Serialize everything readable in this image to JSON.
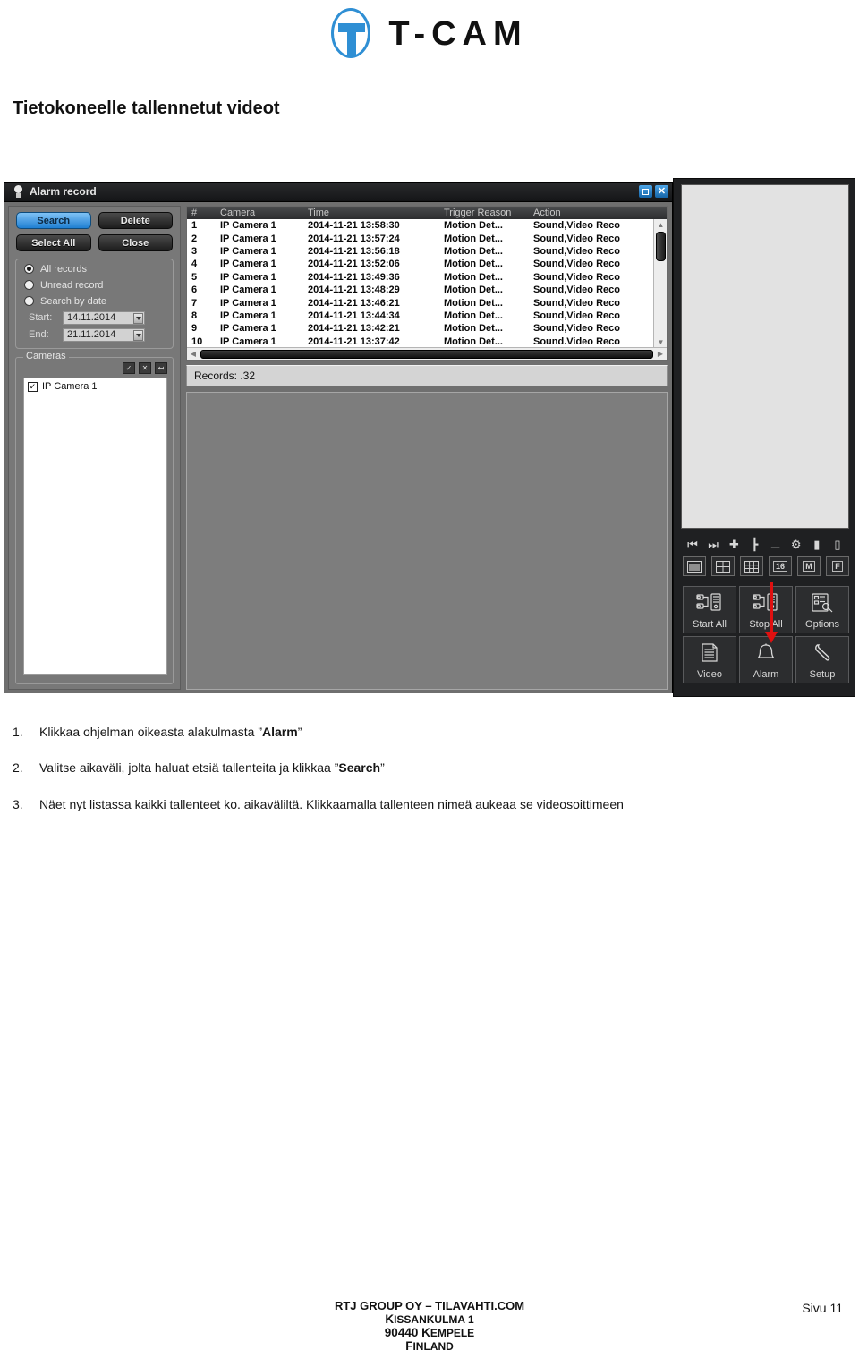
{
  "logo": {
    "mark": "t-cam-logo",
    "text": "T-CAM"
  },
  "page_title": "Tietokoneelle tallennetut videot",
  "app": {
    "titlebar": {
      "title": "Alarm record",
      "restore_label": "□",
      "close_label": "✕"
    },
    "buttons": {
      "search": "Search",
      "delete": "Delete",
      "select_all": "Select All",
      "close": "Close"
    },
    "search_options": {
      "all_records": "All records",
      "unread_record": "Unread record",
      "search_by_date": "Search by date",
      "start_label": "Start:",
      "start_value": "14.11.2014",
      "end_label": "End:",
      "end_value": "21.11.2014",
      "selected": "All records"
    },
    "cameras": {
      "legend": "Cameras",
      "toolbar": [
        "✓",
        "✕",
        "↤"
      ],
      "items": [
        {
          "label": "IP Camera 1",
          "checked": true
        }
      ]
    },
    "table": {
      "headers": [
        "#",
        "Camera",
        "Time",
        "Trigger Reason",
        "Action"
      ],
      "rows": [
        [
          "1",
          "IP Camera 1",
          "2014-11-21 13:58:30",
          "Motion Det...",
          "Sound,Video Reco"
        ],
        [
          "2",
          "IP Camera 1",
          "2014-11-21 13:57:24",
          "Motion Det...",
          "Sound,Video Reco"
        ],
        [
          "3",
          "IP Camera 1",
          "2014-11-21 13:56:18",
          "Motion Det...",
          "Sound,Video Reco"
        ],
        [
          "4",
          "IP Camera 1",
          "2014-11-21 13:52:06",
          "Motion Det...",
          "Sound,Video Reco"
        ],
        [
          "5",
          "IP Camera 1",
          "2014-11-21 13:49:36",
          "Motion Det...",
          "Sound,Video Reco"
        ],
        [
          "6",
          "IP Camera 1",
          "2014-11-21 13:48:29",
          "Motion Det...",
          "Sound,Video Reco"
        ],
        [
          "7",
          "IP Camera 1",
          "2014-11-21 13:46:21",
          "Motion Det...",
          "Sound,Video Reco"
        ],
        [
          "8",
          "IP Camera 1",
          "2014-11-21 13:44:34",
          "Motion Det...",
          "Sound,Video Reco"
        ],
        [
          "9",
          "IP Camera 1",
          "2014-11-21 13:42:21",
          "Motion Det...",
          "Sound,Video Reco"
        ],
        [
          "10",
          "IP Camera 1",
          "2014-11-21 13:37:42",
          "Motion Det...",
          "Sound.Video Reco"
        ]
      ]
    },
    "records_status": "Records: .32",
    "right_panel": {
      "mini_icons": [
        "prev-icon",
        "next-icon",
        "plus-icon",
        "split-icon",
        "minus-icon",
        "gear-icon",
        "window-add-icon",
        "window-remove-icon"
      ],
      "layout_buttons": [
        "single-view",
        "quad-view",
        "nine-view",
        "16",
        "M",
        "F"
      ],
      "big_buttons": [
        {
          "label": "Start All",
          "icon": "start-all-icon"
        },
        {
          "label": "Stop All",
          "icon": "stop-all-icon"
        },
        {
          "label": "Options",
          "icon": "options-icon"
        },
        {
          "label": "Video",
          "icon": "video-icon"
        },
        {
          "label": "Alarm",
          "icon": "alarm-bell-icon"
        },
        {
          "label": "Setup",
          "icon": "wrench-icon"
        }
      ]
    },
    "annotation": {
      "arrow_color": "#e01010",
      "points_to": "Alarm"
    }
  },
  "instructions": [
    {
      "num": "1.",
      "pre": "Klikkaa ohjelman oikeasta alakulmasta ”",
      "bold": "Alarm",
      "post": "”"
    },
    {
      "num": "2.",
      "pre": "Valitse aikaväli, jolta haluat etsiä tallenteita ja klikkaa ”",
      "bold": "Search",
      "post": "”"
    },
    {
      "num": "3.",
      "pre": "Näet nyt listassa kaikki tallenteet ko. aikaväliltä. Klikkaamalla tallenteen nimeä aukeaa se videosoittimeen",
      "bold": "",
      "post": ""
    }
  ],
  "footer": {
    "company": "RTJ GROUP OY – TILAVAHTI.COM",
    "address_line1_cap": "K",
    "address_line1_rest": "ISSANKULMA 1",
    "address_line2_num": "90440 ",
    "address_line2_cap": "K",
    "address_line2_rest": "EMPELE",
    "address_line3_cap": "F",
    "address_line3_rest": "INLAND",
    "page": "Sivu 11"
  },
  "colors": {
    "accent": "#2f8fd4",
    "annotation_red": "#e01010",
    "selected_button": "#1f7fd2"
  }
}
